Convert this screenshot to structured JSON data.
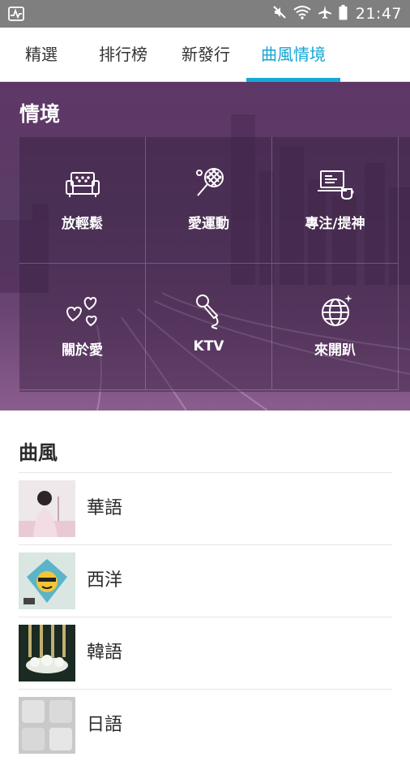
{
  "status_bar": {
    "time": "21:47",
    "icons": [
      "pulse-icon",
      "mute-icon",
      "wifi-icon",
      "airplane-icon",
      "battery-icon"
    ]
  },
  "tabs": [
    {
      "label": "精選",
      "active": false
    },
    {
      "label": "排行榜",
      "active": false
    },
    {
      "label": "新發行",
      "active": false
    },
    {
      "label": "曲風情境",
      "active": true
    }
  ],
  "colors": {
    "accent": "#16a8d6",
    "hero_overlay": "#5e3766",
    "text_dark": "#2b2b2b"
  },
  "scenarios": {
    "title": "情境",
    "items": [
      {
        "label": "放輕鬆",
        "icon": "sofa-icon"
      },
      {
        "label": "愛運動",
        "icon": "tennis-racket-icon"
      },
      {
        "label": "專注/提神",
        "icon": "laptop-coffee-icon"
      },
      {
        "label": "關於愛",
        "icon": "hearts-icon"
      },
      {
        "label": "KTV",
        "icon": "microphone-icon"
      },
      {
        "label": "來開趴",
        "icon": "disco-ball-icon"
      }
    ]
  },
  "genres": {
    "title": "曲風",
    "items": [
      {
        "label": "華語"
      },
      {
        "label": "西洋"
      },
      {
        "label": "韓語"
      },
      {
        "label": "日語"
      }
    ]
  }
}
